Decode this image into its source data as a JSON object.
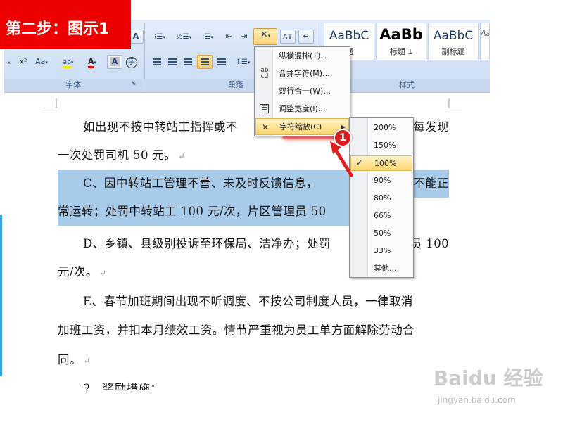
{
  "badge": {
    "text": "第二步：图示1"
  },
  "ribbon": {
    "font_group_label": "字体",
    "paragraph_group_label": "段落",
    "styles_group_label": "样式",
    "styles": [
      {
        "sample": "AaBbC",
        "name": "题"
      },
      {
        "sample": "AaBb",
        "name": "标题 1"
      },
      {
        "sample": "AaBbC",
        "name": "副标题"
      },
      {
        "sample": "Aa",
        "name": ""
      }
    ],
    "font_buttons": {
      "subscript": "ₓ",
      "superscript": "x²",
      "change_case": "Aa",
      "highlight": "ab",
      "font_color": "A",
      "char_shading": "A",
      "enclose": "字"
    }
  },
  "document": {
    "lines": [
      "如出现不按中转站工指挥或不",
      "一次处罚司机 50 元。",
      "C、因中转站工管理不善、未及时反馈信息，",
      "常运转；处罚中转站工 100 元/次，片区管理员 50",
      "D、乡镇、县级别投诉至环保局、洁净办；处罚",
      "元/次。",
      "E、春节加班期间出现不听调度、不按公司制度人员，一律取消",
      "加班工资，并扣本月绩效工资。情节严重视为员工单方面解除劳动合",
      "同。",
      "2、奖励措施："
    ],
    "line1_tail": "每发现",
    "line3_tail": "不能正",
    "line5_tail": "员  100",
    "paragraph_mark": "↵"
  },
  "menu": {
    "items": [
      {
        "label": "纵横混排(T)...",
        "icon": "vertical-horizontal-icon"
      },
      {
        "label": "合并字符(M)...",
        "icon": "combine-chars-icon"
      },
      {
        "label": "双行合一(W)...",
        "icon": "two-lines-in-one-icon"
      },
      {
        "label": "调整宽度(I)...",
        "icon": "adjust-width-icon"
      },
      {
        "label": "字符缩放(C)",
        "icon": "char-scale-icon"
      }
    ]
  },
  "submenu": {
    "items": [
      "200%",
      "150%",
      "100%",
      "90%",
      "80%",
      "66%",
      "50%",
      "33%",
      "其他..."
    ],
    "checked": "100%"
  },
  "annotation": {
    "step_number": "1"
  },
  "watermark": {
    "logo": "Baidu 经验",
    "url": "jingyan.baidu.com"
  },
  "colors": {
    "badge_red": "#ee0000",
    "highlight_blue": "#a9cbea",
    "menu_selection": "#ffd76e",
    "annotation_red": "#d81e1e"
  }
}
